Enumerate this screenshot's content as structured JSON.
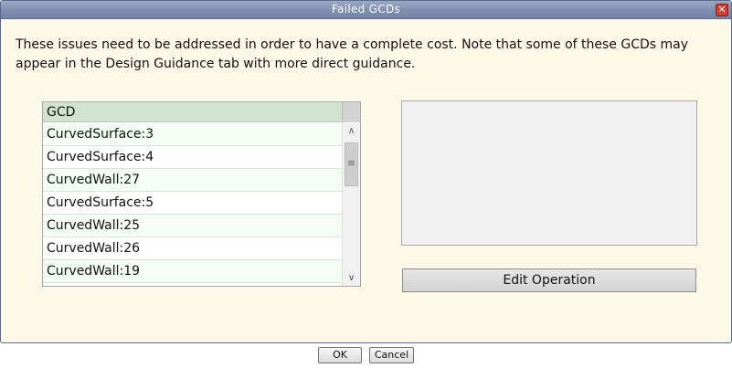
{
  "window": {
    "title": "Failed GCDs",
    "close_symbol": "✕"
  },
  "message": "These issues need to be addressed in order to have a complete cost. Note that some of these GCDs may appear in the Design Guidance tab with more direct guidance.",
  "list": {
    "header": "GCD",
    "rows": [
      "CurvedSurface:3",
      "CurvedSurface:4",
      "CurvedWall:27",
      "CurvedSurface:5",
      "CurvedWall:25",
      "CurvedWall:26",
      "CurvedWall:19"
    ],
    "scroll_up_icon": "chevron-up-icon",
    "scroll_down_icon": "chevron-down-icon"
  },
  "edit_button_label": "Edit Operation",
  "footer": {
    "ok_label": "OK",
    "cancel_label": "Cancel"
  },
  "colors": {
    "dialog_bg": "#fdf9e8",
    "titlebar": "#8595b8",
    "list_header": "#cfe3cf",
    "close_button": "#d43a2c"
  }
}
